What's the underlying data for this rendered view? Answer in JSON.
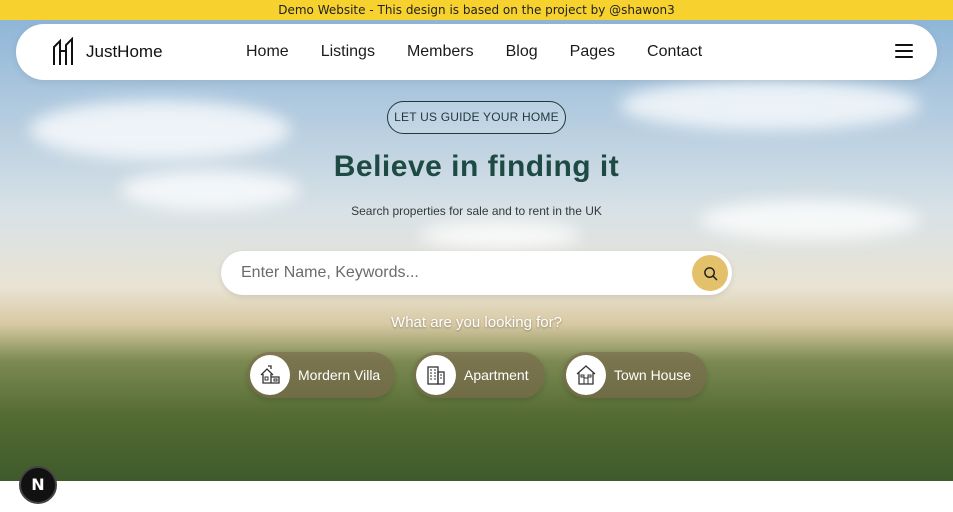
{
  "banner": {
    "text": "Demo Website - This design is based on the project by @shawon3"
  },
  "nav": {
    "logo_text": "JustHome",
    "links": [
      "Home",
      "Listings",
      "Members",
      "Blog",
      "Pages",
      "Contact"
    ],
    "menu_icon": "hamburger-menu-icon"
  },
  "hero": {
    "pill": "LET US GUIDE YOUR HOME",
    "title": "Believe in finding it",
    "subtitle": "Search properties for sale and to rent in the UK",
    "search_placeholder": "Enter Name, Keywords...",
    "search_icon": "search-icon",
    "looking_for": "What are you looking for?",
    "categories": [
      {
        "label": "Mordern Villa",
        "icon": "villa-icon"
      },
      {
        "label": "Apartment",
        "icon": "apartment-icon"
      },
      {
        "label": "Town House",
        "icon": "town-house-icon"
      }
    ]
  },
  "dev_badge": "N",
  "colors": {
    "banner": "#f7d22e",
    "accent": "#e3c06a",
    "title": "#1e4a44"
  }
}
